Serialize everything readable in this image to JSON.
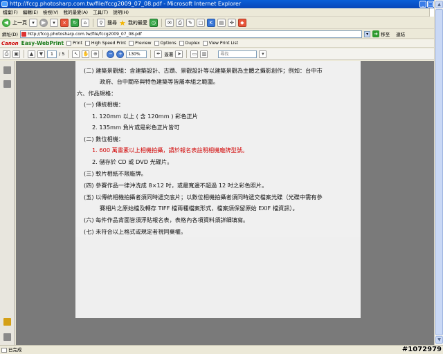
{
  "window": {
    "title": "http://fccg.photosharp.com.tw/file/fccg2009_07_08.pdf - Microsoft Internet Explorer",
    "min": "_",
    "max": "□",
    "close": "×"
  },
  "menu": [
    "檔案(F)",
    "編輯(E)",
    "檢視(V)",
    "我的最愛(A)",
    "工具(T)",
    "說明(H)"
  ],
  "nav": {
    "back_label": "上一頁",
    "search_label": "搜尋",
    "favorites_label": "我的最愛"
  },
  "address": {
    "label": "網址(D)",
    "url": "http://fccg.photosharp.com.tw/file/fccg2009_07_08.pdf",
    "go_label": "移至",
    "links_label": "連結"
  },
  "canon": {
    "brand": "Canon",
    "product": "Easy-WebPrint",
    "items": [
      "Print",
      "High Speed Print",
      "Preview",
      "Options",
      "Duplex",
      "View Print List"
    ]
  },
  "pdf_toolbar": {
    "page_current": "1",
    "page_total": "/ 5",
    "zoom": "130%",
    "sign_label": "簽署",
    "find_placeholder": "尋找"
  },
  "document": {
    "lines": [
      {
        "text": "(二)  建築景觀組：含建築設計、古蹟、景觀設計等以建築景觀為主體之攝影創作；例如：台中市",
        "red": false
      },
      {
        "text": "政府、台中關帝與特色建築等皆屬本組之範圍。",
        "red": false
      },
      {
        "text": "六、作品規格：",
        "red": false
      },
      {
        "text": "(一)  傳統相機：",
        "red": false
      },
      {
        "text": "1.       120mm 以上 ( 含 120mm ) 彩色正片",
        "red": false
      },
      {
        "text": "2.       135mm  負片或是彩色正片皆可",
        "red": false
      },
      {
        "text": "(二)  數位相機：",
        "red": false
      },
      {
        "text": "1.       600 萬畫素以上相機拍攝，請於報名表註明相機廠牌型號。",
        "red": true
      },
      {
        "text": "2.       儲存於 CD 或 DVD 光碟片。",
        "red": false
      },
      {
        "text": "(三)  軟片相紙不限廠牌。",
        "red": false
      },
      {
        "text": "(四)  參賽作品一律沖洗成 8×12 吋，或最寬邊不超過 12 吋之彩色照片。",
        "red": false
      },
      {
        "text": "(五)  以傳統相機拍攝者須同時遞交底片；以數位相機拍攝者須同時遞交檔案光碟（光碟中需有參",
        "red": false
      },
      {
        "text": "賽相片之原始檔及轉存 TIFF 檔兩種檔案形式，檔案須保留原始 EXIF 檔資訊）。",
        "red": false
      },
      {
        "text": "(六)  每件作品背面皆須浮貼報名表，表格內各項資料須詳細填寫。",
        "red": false
      },
      {
        "text": "(七)  未符合以上格式或規定者視同棄權。",
        "red": false
      }
    ]
  },
  "status": {
    "text": "已完成",
    "watermark": "#1072979"
  }
}
